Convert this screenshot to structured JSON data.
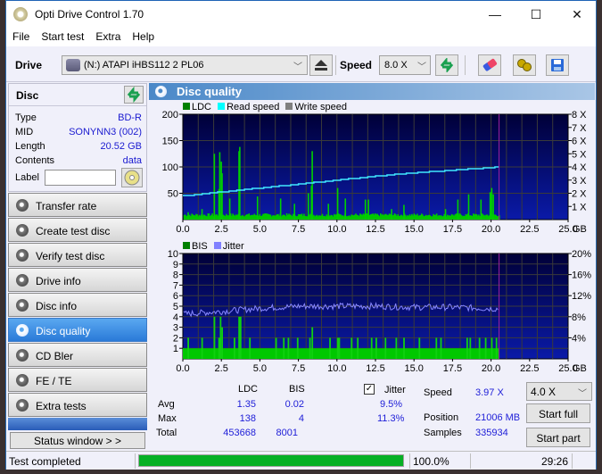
{
  "window": {
    "title": "Opti Drive Control 1.70",
    "controls": {
      "minimize": "—",
      "maximize": "☐",
      "close": "✕"
    }
  },
  "menu": [
    "File",
    "Start test",
    "Extra",
    "Help"
  ],
  "toolbar": {
    "drive_label": "Drive",
    "drive_value": "(N:)  ATAPI iHBS112  2 PL06",
    "speed_label": "Speed",
    "speed_value": "8.0 X",
    "icons": [
      "eject-icon",
      "refresh-icon",
      "eraser-icon",
      "settings-icon",
      "save-icon"
    ]
  },
  "disc": {
    "title": "Disc",
    "fields": [
      {
        "key": "Type",
        "value": "BD-R"
      },
      {
        "key": "MID",
        "value": "SONYNN3 (002)"
      },
      {
        "key": "Length",
        "value": "20.52 GB"
      },
      {
        "key": "Contents",
        "value": "data"
      }
    ],
    "label_key": "Label",
    "label_value": ""
  },
  "nav": [
    {
      "label": "Transfer rate",
      "active": false
    },
    {
      "label": "Create test disc",
      "active": false
    },
    {
      "label": "Verify test disc",
      "active": false
    },
    {
      "label": "Drive info",
      "active": false
    },
    {
      "label": "Disc info",
      "active": false
    },
    {
      "label": "Disc quality",
      "active": true
    },
    {
      "label": "CD Bler",
      "active": false
    },
    {
      "label": "FE / TE",
      "active": false
    },
    {
      "label": "Extra tests",
      "active": false
    }
  ],
  "status_window_label": "Status window > >",
  "panel_title": "Disc quality",
  "chart_data": [
    {
      "type": "bar",
      "title": "LDC / Read speed",
      "legend": [
        {
          "name": "LDC",
          "color": "#008000"
        },
        {
          "name": "Read speed",
          "color": "#00ffff"
        },
        {
          "name": "Write speed",
          "color": "#808080"
        }
      ],
      "x_ticks": [
        "0.0",
        "2.5",
        "5.0",
        "7.5",
        "10.0",
        "12.5",
        "15.0",
        "17.5",
        "20.0",
        "22.5",
        "25.0"
      ],
      "x_unit": "GB",
      "xlim": [
        0,
        25
      ],
      "y_left_ticks": [
        "50",
        "100",
        "150",
        "200"
      ],
      "ylim_left": [
        0,
        200
      ],
      "y_right_ticks": [
        "1 X",
        "2 X",
        "3 X",
        "4 X",
        "5 X",
        "6 X",
        "7 X",
        "8 X"
      ],
      "ylim_right": [
        0,
        8
      ],
      "end_marker_gb": 20.52,
      "ldc_peaks": [
        [
          0.3,
          14
        ],
        [
          1.2,
          20
        ],
        [
          2.0,
          125
        ],
        [
          2.3,
          58
        ],
        [
          2.35,
          128
        ],
        [
          2.45,
          110
        ],
        [
          2.5,
          88
        ],
        [
          3.0,
          40
        ],
        [
          3.6,
          130
        ],
        [
          3.65,
          138
        ],
        [
          4.8,
          44
        ],
        [
          6.3,
          40
        ],
        [
          7.2,
          30
        ],
        [
          8.1,
          50
        ],
        [
          8.3,
          64
        ],
        [
          8.35,
          130
        ],
        [
          9.4,
          30
        ],
        [
          10.0,
          60
        ],
        [
          10.5,
          40
        ],
        [
          11.8,
          38
        ],
        [
          12.0,
          38
        ],
        [
          13.5,
          20
        ],
        [
          14.3,
          28
        ],
        [
          17.0,
          20
        ],
        [
          17.8,
          38
        ],
        [
          18.5,
          48
        ],
        [
          19.3,
          38
        ],
        [
          19.9,
          52
        ],
        [
          20.0,
          60
        ],
        [
          20.1,
          48
        ]
      ],
      "ldc_baseline": 6,
      "read_speed": [
        [
          0,
          1.8
        ],
        [
          2.5,
          2.1
        ],
        [
          5,
          2.4
        ],
        [
          7.5,
          2.7
        ],
        [
          10,
          3.0
        ],
        [
          12.5,
          3.3
        ],
        [
          15,
          3.55
        ],
        [
          17.5,
          3.75
        ],
        [
          20.52,
          4.0
        ]
      ]
    },
    {
      "type": "bar",
      "title": "BIS / Jitter",
      "legend": [
        {
          "name": "BIS",
          "color": "#008000"
        },
        {
          "name": "Jitter",
          "color": "#8080ff"
        }
      ],
      "x_ticks": [
        "0.0",
        "2.5",
        "5.0",
        "7.5",
        "10.0",
        "12.5",
        "15.0",
        "17.5",
        "20.0",
        "22.5",
        "25.0"
      ],
      "x_unit": "GB",
      "xlim": [
        0,
        25
      ],
      "y_left_ticks": [
        "1",
        "2",
        "3",
        "4",
        "5",
        "6",
        "7",
        "8",
        "9",
        "10"
      ],
      "ylim_left": [
        0,
        10
      ],
      "y_right_ticks": [
        "4%",
        "8%",
        "12%",
        "16%",
        "20%"
      ],
      "ylim_right": [
        0,
        20
      ],
      "end_marker_gb": 20.52,
      "bis_spikes": [
        [
          0.3,
          2
        ],
        [
          1.2,
          2
        ],
        [
          2.0,
          4
        ],
        [
          2.3,
          2
        ],
        [
          2.4,
          4
        ],
        [
          2.5,
          3
        ],
        [
          3.3,
          2
        ],
        [
          3.6,
          4
        ],
        [
          3.7,
          4
        ],
        [
          4.3,
          2
        ],
        [
          6.0,
          2
        ],
        [
          6.5,
          2
        ],
        [
          6.8,
          2
        ],
        [
          7.4,
          2
        ],
        [
          8.2,
          2
        ],
        [
          8.35,
          3
        ],
        [
          9.5,
          2
        ],
        [
          10.0,
          2
        ],
        [
          10.1,
          2
        ],
        [
          10.9,
          2
        ],
        [
          11.3,
          2
        ],
        [
          12.2,
          2
        ],
        [
          12.5,
          2
        ],
        [
          13.1,
          2
        ],
        [
          13.8,
          2
        ],
        [
          14.3,
          2
        ],
        [
          15.3,
          2
        ],
        [
          16.4,
          2
        ],
        [
          16.7,
          2
        ],
        [
          18.4,
          2
        ],
        [
          18.6,
          2
        ],
        [
          19.2,
          2
        ],
        [
          19.6,
          2
        ],
        [
          20.0,
          2
        ],
        [
          20.3,
          2
        ]
      ],
      "bis_baseline": 1,
      "jitter": [
        [
          0,
          8.5
        ],
        [
          2.5,
          9.0
        ],
        [
          5,
          9.6
        ],
        [
          7.5,
          10.0
        ],
        [
          10,
          10.0
        ],
        [
          12.5,
          10.0
        ],
        [
          15,
          9.8
        ],
        [
          17.5,
          9.8
        ],
        [
          20.52,
          9.5
        ]
      ]
    }
  ],
  "stats": {
    "col_ldc": "LDC",
    "col_bis": "BIS",
    "jitter_label": "Jitter",
    "jitter_checked": true,
    "rows": [
      {
        "label": "Avg",
        "ldc": "1.35",
        "bis": "0.02",
        "jitter": "9.5%"
      },
      {
        "label": "Max",
        "ldc": "138",
        "bis": "4",
        "jitter": "11.3%"
      },
      {
        "label": "Total",
        "ldc": "453668",
        "bis": "8001",
        "jitter": ""
      }
    ],
    "speed_label": "Speed",
    "speed_value": "3.97 X",
    "position_label": "Position",
    "position_value": "21006 MB",
    "samples_label": "Samples",
    "samples_value": "335934",
    "speed_select": "4.0 X",
    "start_full": "Start full",
    "start_part": "Start part"
  },
  "statusbar": {
    "text": "Test completed",
    "progress": 100.0,
    "progress_label": "100.0%",
    "time": "29:26"
  }
}
